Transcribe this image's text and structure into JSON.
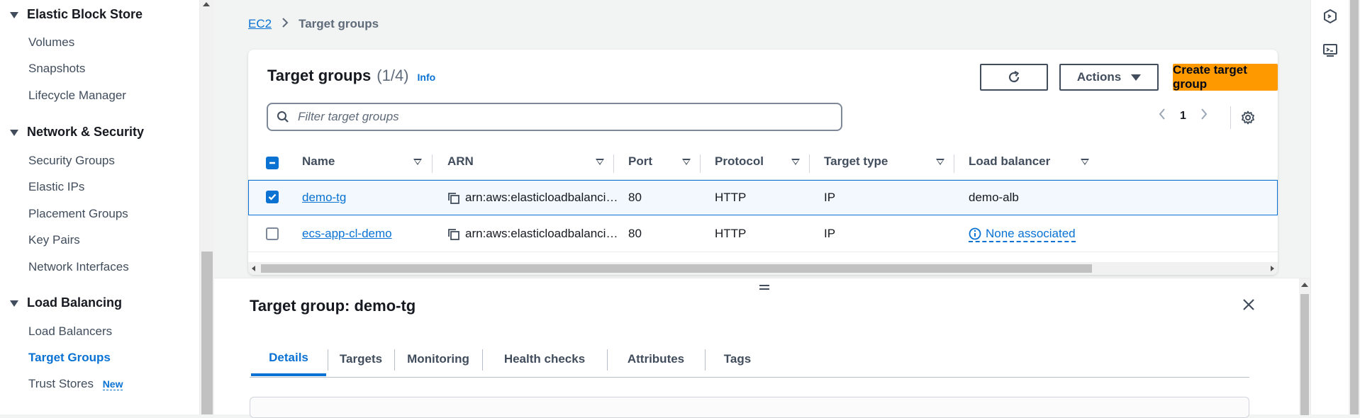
{
  "sidebar": {
    "sections": [
      {
        "title": "Elastic Block Store",
        "items": [
          "Volumes",
          "Snapshots",
          "Lifecycle Manager"
        ]
      },
      {
        "title": "Network & Security",
        "items": [
          "Security Groups",
          "Elastic IPs",
          "Placement Groups",
          "Key Pairs",
          "Network Interfaces"
        ]
      },
      {
        "title": "Load Balancing",
        "items": [
          "Load Balancers",
          "Target Groups",
          "Trust Stores"
        ]
      }
    ],
    "active_item": "Target Groups",
    "new_badge": "New"
  },
  "breadcrumb": {
    "root": "EC2",
    "current": "Target groups"
  },
  "panel": {
    "title": "Target groups",
    "count": "(1/4)",
    "info": "Info",
    "actions_label": "Actions",
    "create_label": "Create target group",
    "filter_placeholder": "Filter target groups",
    "page_number": "1"
  },
  "table": {
    "columns": [
      "Name",
      "ARN",
      "Port",
      "Protocol",
      "Target type",
      "Load balancer"
    ],
    "rows": [
      {
        "name": "demo-tg",
        "arn": "arn:aws:elasticloadbalanci…",
        "port": "80",
        "protocol": "HTTP",
        "target_type": "IP",
        "load_balancer": "demo-alb",
        "selected": true
      },
      {
        "name": "ecs-app-cl-demo",
        "arn": "arn:aws:elasticloadbalanci…",
        "port": "80",
        "protocol": "HTTP",
        "target_type": "IP",
        "load_balancer": "None associated",
        "selected": false
      }
    ]
  },
  "split_panel": {
    "title": "Target group: demo-tg",
    "tabs": [
      "Details",
      "Targets",
      "Monitoring",
      "Health checks",
      "Attributes",
      "Tags"
    ],
    "active_tab": "Details"
  },
  "colors": {
    "accent": "#0972d3",
    "primary_button": "#ff9900",
    "text": "#16191f"
  }
}
